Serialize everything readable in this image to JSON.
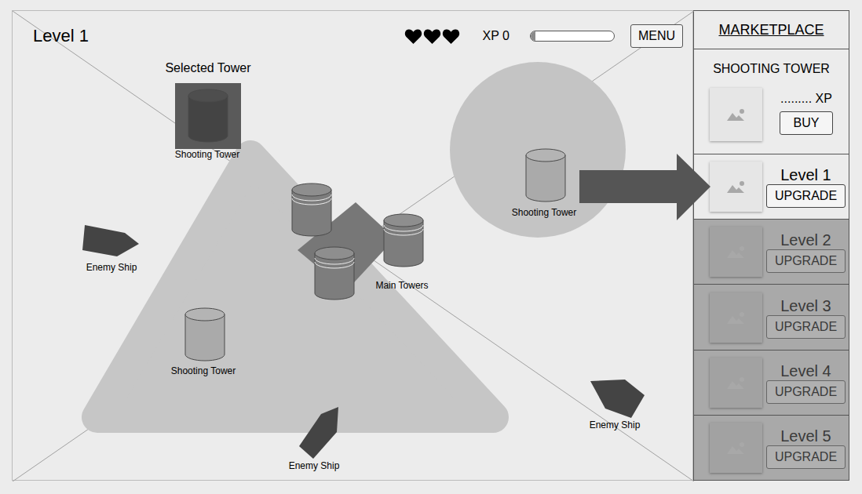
{
  "hud": {
    "level_title": "Level 1",
    "lives": 3,
    "xp": "XP 0",
    "xp_level": 0.06,
    "menu": "MENU"
  },
  "selected_tower": {
    "heading": "Selected Tower",
    "label": "Shooting Tower"
  },
  "map": {
    "main_towers_label": "Main Towers",
    "shooting_towers": [
      {
        "label": "Shooting Tower",
        "highlighted": true
      },
      {
        "label": "Shooting Tower",
        "highlighted": false
      }
    ],
    "enemy_ships": [
      {
        "label": "Enemy Ship"
      },
      {
        "label": "Enemy Ship"
      },
      {
        "label": "Enemy Ship"
      }
    ]
  },
  "marketplace": {
    "title": "MARKETPLACE",
    "product": {
      "name": "SHOOTING TOWER",
      "price": "......... XP",
      "buy": "BUY"
    },
    "upgrades": [
      {
        "label": "Level 1",
        "button": "UPGRADE",
        "disabled": false
      },
      {
        "label": "Level 2",
        "button": "UPGRADE",
        "disabled": true
      },
      {
        "label": "Level 3",
        "button": "UPGRADE",
        "disabled": true
      },
      {
        "label": "Level 4",
        "button": "UPGRADE",
        "disabled": true
      },
      {
        "label": "Level 5",
        "button": "UPGRADE",
        "disabled": true
      }
    ]
  }
}
